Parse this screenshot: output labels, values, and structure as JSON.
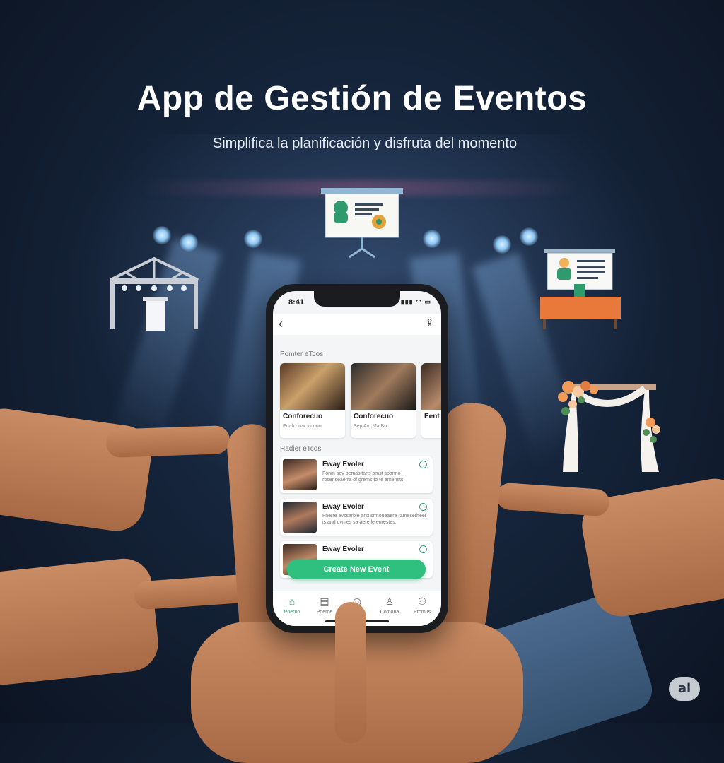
{
  "hero": {
    "title": "App de Gestión de Eventos",
    "subtitle": "Simplifica la planificación y disfruta del momento"
  },
  "illustrations": [
    {
      "name": "stage-truss-icon"
    },
    {
      "name": "presentation-board-icon"
    },
    {
      "name": "conference-desk-icon"
    },
    {
      "name": "wedding-arch-icon"
    }
  ],
  "phone": {
    "status": {
      "time": "8:41",
      "icons": "▮▮▮ ◠ ▭"
    },
    "nav": {
      "back_icon": "‹",
      "share_icon": "⇪"
    },
    "featured": {
      "label": "Pomter eTcos",
      "cards": [
        {
          "title": "Conforecuo",
          "date": "Enab dnar vicono"
        },
        {
          "title": "Conforecuo",
          "date": "Sep Anr Ma Bo"
        },
        {
          "title": "Eent",
          "date": ""
        }
      ]
    },
    "upcoming": {
      "label": "Hadier eTcos",
      "items": [
        {
          "name": "Eway Evoler",
          "desc": "Fonm sev bemasitans pmst sbanno rbsenseaerra of grems fo te amensts."
        },
        {
          "name": "Eway Evoler",
          "desc": "Fnerre avssarble arst srmoueaere rameserheer is and dvmes sa aere le enrestes."
        },
        {
          "name": "Eway Evoler",
          "desc": ""
        }
      ]
    },
    "cta_label": "Create New Event",
    "tabs": [
      {
        "icon": "⌂",
        "label": "Poerno",
        "active": true
      },
      {
        "icon": "▤",
        "label": "Poeroe",
        "active": false
      },
      {
        "icon": "◎",
        "label": "",
        "active": false
      },
      {
        "icon": "♙",
        "label": "Comona",
        "active": false
      },
      {
        "icon": "⚇",
        "label": "Promus",
        "active": false
      }
    ]
  },
  "badge_text": "ai"
}
